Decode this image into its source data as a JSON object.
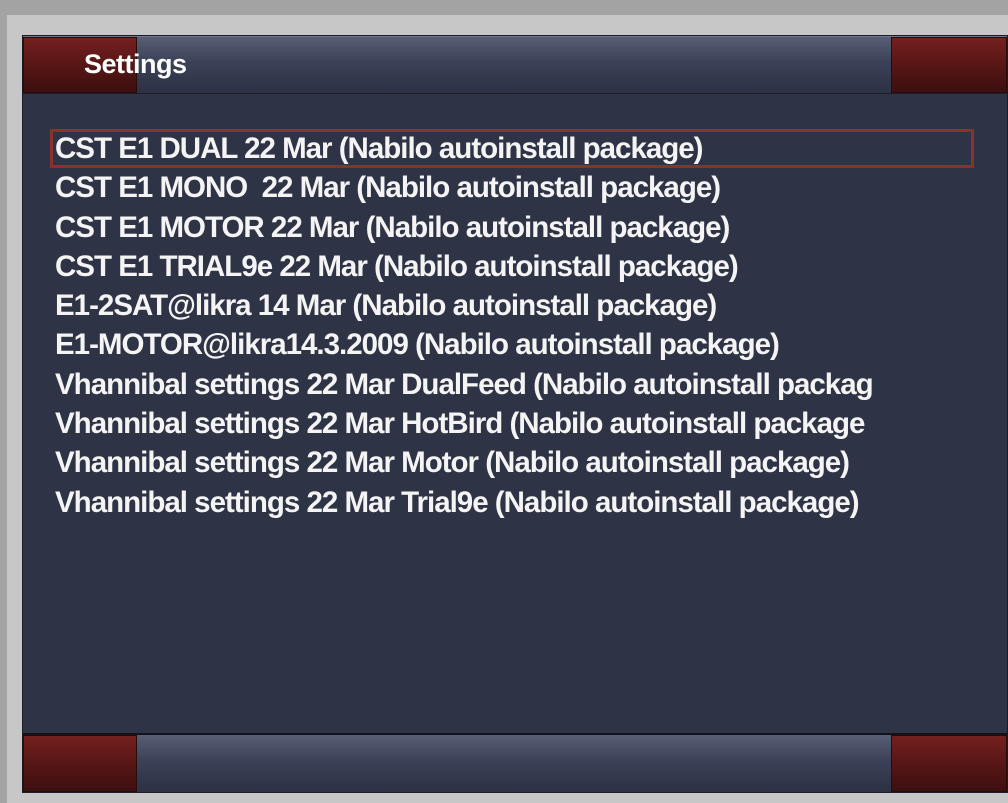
{
  "window": {
    "title": "Settings"
  },
  "list": {
    "selected_index": 0,
    "items": [
      "CST E1 DUAL 22 Mar (Nabilo autoinstall package)",
      "CST E1 MONO  22 Mar (Nabilo autoinstall package)",
      "CST E1 MOTOR 22 Mar (Nabilo autoinstall package)",
      "CST E1 TRIAL9e 22 Mar (Nabilo autoinstall package)",
      "E1-2SAT@likra 14 Mar (Nabilo autoinstall package)",
      "E1-MOTOR@likra14.3.2009 (Nabilo autoinstall package)",
      "Vhannibal settings 22 Mar DualFeed (Nabilo autoinstall packag",
      "Vhannibal settings 22 Mar HotBird (Nabilo autoinstall package",
      "Vhannibal settings 22 Mar Motor (Nabilo autoinstall package)",
      "Vhannibal settings 22 Mar Trial9e (Nabilo autoinstall package)"
    ]
  },
  "colors": {
    "background": "#2f3346",
    "accent_red": "#74201f",
    "selection_border": "#8b2f2f",
    "text": "#f4f4f4"
  }
}
